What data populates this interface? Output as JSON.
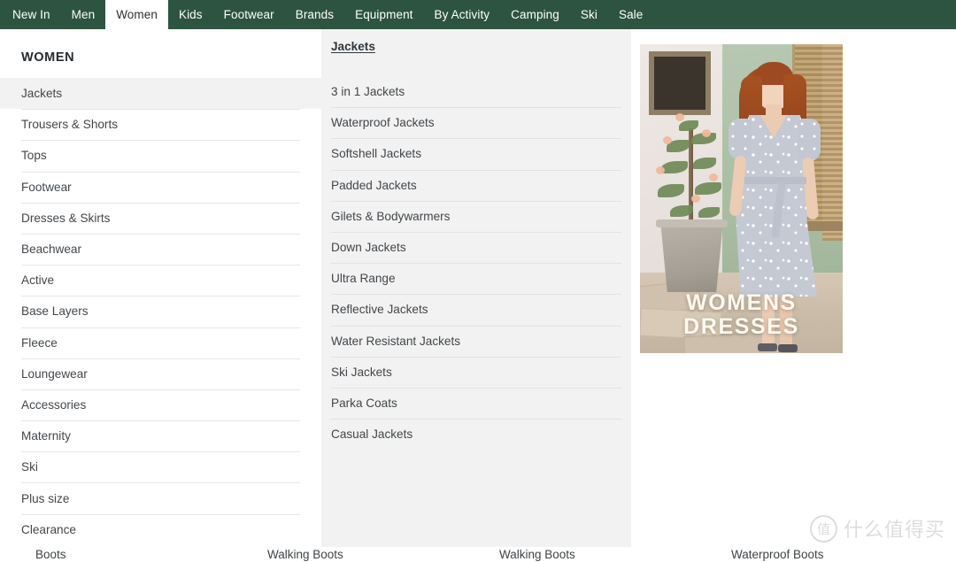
{
  "topnav": {
    "background_color": "#2d5441",
    "active_text_color": "#2b2f33",
    "items": [
      {
        "label": "New In",
        "active": false
      },
      {
        "label": "Men",
        "active": false
      },
      {
        "label": "Women",
        "active": true
      },
      {
        "label": "Kids",
        "active": false
      },
      {
        "label": "Footwear",
        "active": false
      },
      {
        "label": "Brands",
        "active": false
      },
      {
        "label": "Equipment",
        "active": false
      },
      {
        "label": "By Activity",
        "active": false
      },
      {
        "label": "Camping",
        "active": false
      },
      {
        "label": "Ski",
        "active": false
      },
      {
        "label": "Sale",
        "active": false
      }
    ]
  },
  "megamenu": {
    "title": "WOMEN",
    "categories": [
      {
        "label": "Jackets",
        "selected": true
      },
      {
        "label": "Trousers & Shorts",
        "selected": false
      },
      {
        "label": "Tops",
        "selected": false
      },
      {
        "label": "Footwear",
        "selected": false
      },
      {
        "label": "Dresses & Skirts",
        "selected": false
      },
      {
        "label": "Beachwear",
        "selected": false
      },
      {
        "label": "Active",
        "selected": false
      },
      {
        "label": "Base Layers",
        "selected": false
      },
      {
        "label": "Fleece",
        "selected": false
      },
      {
        "label": "Loungewear",
        "selected": false
      },
      {
        "label": "Accessories",
        "selected": false
      },
      {
        "label": "Maternity",
        "selected": false
      },
      {
        "label": "Ski",
        "selected": false
      },
      {
        "label": "Plus size",
        "selected": false
      },
      {
        "label": "Clearance",
        "selected": false
      }
    ],
    "subcategory_heading": "Jackets",
    "subcategories": [
      {
        "label": "3 in 1 Jackets"
      },
      {
        "label": "Waterproof Jackets"
      },
      {
        "label": "Softshell Jackets"
      },
      {
        "label": "Padded Jackets"
      },
      {
        "label": "Gilets & Bodywarmers"
      },
      {
        "label": "Down Jackets"
      },
      {
        "label": "Ultra Range"
      },
      {
        "label": "Reflective Jackets"
      },
      {
        "label": "Water Resistant Jackets"
      },
      {
        "label": "Ski Jackets"
      },
      {
        "label": "Parka Coats"
      },
      {
        "label": "Casual Jackets"
      }
    ],
    "promo": {
      "caption_line1": "WOMENS",
      "caption_line2": "DRESSES"
    }
  },
  "background_page": {
    "row_items": [
      "Boots",
      "Walking Boots",
      "Walking Boots",
      "Waterproof Boots"
    ]
  },
  "watermark": {
    "logo_glyph": "值",
    "text": "什么值得买"
  }
}
